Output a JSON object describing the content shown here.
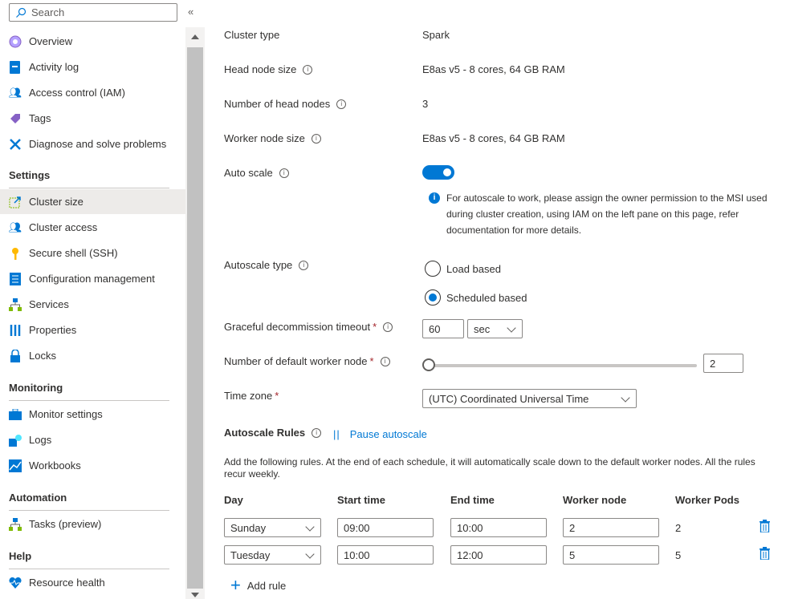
{
  "sidebar": {
    "search_placeholder": "Search",
    "items_top": [
      {
        "label": "Overview"
      },
      {
        "label": "Activity log"
      },
      {
        "label": "Access control (IAM)"
      },
      {
        "label": "Tags"
      },
      {
        "label": "Diagnose and solve problems"
      }
    ],
    "settings": {
      "title": "Settings",
      "items": [
        {
          "label": "Cluster size"
        },
        {
          "label": "Cluster access"
        },
        {
          "label": "Secure shell (SSH)"
        },
        {
          "label": "Configuration management"
        },
        {
          "label": "Services"
        },
        {
          "label": "Properties"
        },
        {
          "label": "Locks"
        }
      ]
    },
    "monitoring": {
      "title": "Monitoring",
      "items": [
        {
          "label": "Monitor settings"
        },
        {
          "label": "Logs"
        },
        {
          "label": "Workbooks"
        }
      ]
    },
    "automation": {
      "title": "Automation",
      "items": [
        {
          "label": "Tasks (preview)"
        }
      ]
    },
    "help": {
      "title": "Help",
      "items": [
        {
          "label": "Resource health"
        }
      ]
    }
  },
  "form": {
    "cluster_type": {
      "label": "Cluster type",
      "value": "Spark"
    },
    "head_node_size": {
      "label": "Head node size",
      "value": "E8as v5 - 8 cores, 64 GB RAM"
    },
    "num_head_nodes": {
      "label": "Number of head nodes",
      "value": "3"
    },
    "worker_node_size": {
      "label": "Worker node size",
      "value": "E8as v5 - 8 cores, 64 GB RAM"
    },
    "auto_scale": {
      "label": "Auto scale",
      "enabled": true,
      "info": "For autoscale to work, please assign the owner permission to the MSI used during cluster creation, using IAM on the left pane on this page, refer documentation for more details."
    },
    "autoscale_type": {
      "label": "Autoscale type",
      "options": [
        "Load based",
        "Scheduled based"
      ],
      "selected": "Scheduled based"
    },
    "graceful": {
      "label": "Graceful decommission timeout",
      "value": "60",
      "unit": "sec"
    },
    "default_workers": {
      "label": "Number of default worker node",
      "value": "2",
      "slider_fraction": 0
    },
    "time_zone": {
      "label": "Time zone",
      "value": "(UTC) Coordinated Universal Time"
    }
  },
  "rules": {
    "title": "Autoscale Rules",
    "pause": "Pause autoscale",
    "description": "Add the following rules. At the end of each schedule, it will automatically scale down to the default worker nodes. All the rules recur weekly.",
    "headers": [
      "Day",
      "Start time",
      "End time",
      "Worker node",
      "Worker Pods"
    ],
    "rows": [
      {
        "day": "Sunday",
        "start": "09:00",
        "end": "10:00",
        "node": "2",
        "pods": "2"
      },
      {
        "day": "Tuesday",
        "start": "10:00",
        "end": "12:00",
        "node": "5",
        "pods": "5"
      }
    ],
    "add": "Add rule"
  },
  "colors": {
    "accent": "#0078d4",
    "required": "#a4262c"
  }
}
